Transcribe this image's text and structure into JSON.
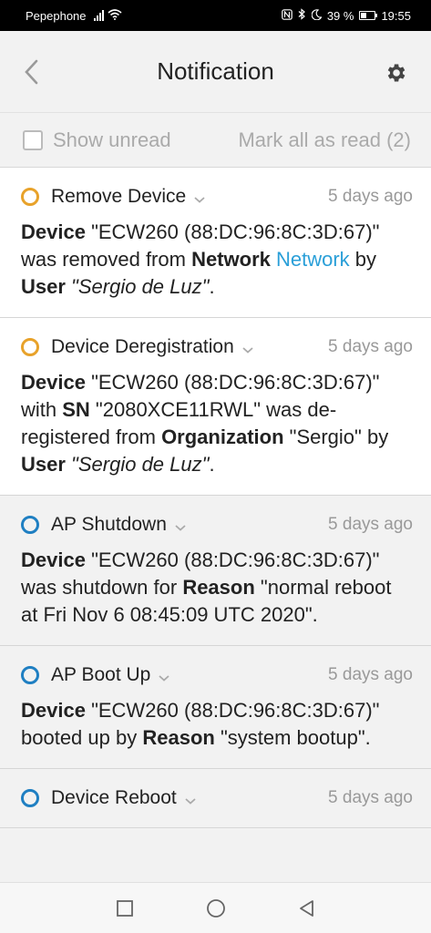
{
  "statusbar": {
    "carrier": "Pepephone",
    "battery": "39 %",
    "battery_level": 0.39,
    "time": "19:55",
    "icons": [
      "signal-icon",
      "wifi-icon",
      "nfc-icon",
      "bluetooth-icon",
      "moon-icon",
      "battery-icon"
    ]
  },
  "appbar": {
    "title": "Notification",
    "back_icon": "chevron-left-icon",
    "settings_icon": "gear-icon"
  },
  "filter": {
    "show_unread_label": "Show unread",
    "show_unread_checked": false,
    "mark_all_label": "Mark all as read (2)"
  },
  "notifications": [
    {
      "title": "Remove Device",
      "time": "5 days ago",
      "status_color": "#e8a22a",
      "parts": [
        {
          "t": "Device",
          "s": "b"
        },
        {
          "t": " \"ECW260 (88:DC:96:8C:3D:67)\" was removed from "
        },
        {
          "t": "Network",
          "s": "b"
        },
        {
          "t": " "
        },
        {
          "t": "Network",
          "s": "link"
        },
        {
          "t": " by "
        },
        {
          "t": "User",
          "s": "b"
        },
        {
          "t": " "
        },
        {
          "t": "\"Sergio de Luz\"",
          "s": "i"
        },
        {
          "t": "."
        }
      ]
    },
    {
      "title": "Device Deregistration",
      "time": "5 days ago",
      "status_color": "#e8a22a",
      "parts": [
        {
          "t": "Device",
          "s": "b"
        },
        {
          "t": " \"ECW260 (88:DC:96:8C:3D:67)\" with "
        },
        {
          "t": "SN",
          "s": "b"
        },
        {
          "t": " \"2080XCE11RWL\" was de-registered from "
        },
        {
          "t": "Organization",
          "s": "b"
        },
        {
          "t": " \"Sergio\" by "
        },
        {
          "t": "User",
          "s": "b"
        },
        {
          "t": " "
        },
        {
          "t": "\"Sergio de Luz\"",
          "s": "i"
        },
        {
          "t": "."
        }
      ]
    },
    {
      "title": "AP Shutdown",
      "time": "5 days ago",
      "status_color": "#1f7fc2",
      "parts": [
        {
          "t": "Device",
          "s": "b"
        },
        {
          "t": " \"ECW260 (88:DC:96:8C:3D:67)\" was shutdown for "
        },
        {
          "t": "Reason",
          "s": "b"
        },
        {
          "t": " \"normal reboot at Fri Nov 6 08:45:09 UTC 2020\"."
        }
      ]
    },
    {
      "title": "AP Boot Up",
      "time": "5 days ago",
      "status_color": "#1f7fc2",
      "parts": [
        {
          "t": "Device",
          "s": "b"
        },
        {
          "t": " \"ECW260 (88:DC:96:8C:3D:67)\" booted up by "
        },
        {
          "t": "Reason",
          "s": "b"
        },
        {
          "t": " \"system bootup\"."
        }
      ]
    },
    {
      "title": "Device Reboot",
      "time": "5 days ago",
      "status_color": "#1f7fc2",
      "parts": []
    }
  ],
  "navbar": {
    "icons": [
      "recent-apps-icon",
      "home-icon",
      "back-triangle-icon"
    ]
  }
}
